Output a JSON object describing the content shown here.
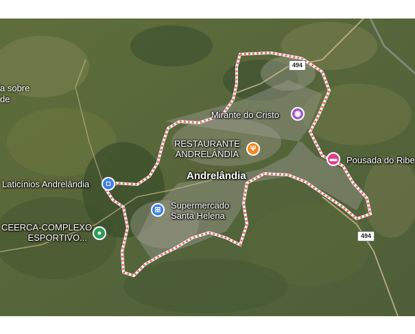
{
  "map": {
    "town_label": "Andrelândia",
    "left_edge_text": [
      "a sobre",
      "de"
    ],
    "road_shield": "494",
    "places": [
      {
        "name": "Mirante do Cristo",
        "icon": "camera-icon",
        "color": "#a259c4"
      },
      {
        "name": "RESTAURANTE\nANDRELÂNDIA",
        "icon": "fork-knife-icon",
        "color": "#f08a24"
      },
      {
        "name": "Pousada do Ribe",
        "icon": "bed-icon",
        "color": "#e0408a"
      },
      {
        "name": "Laticínios Andrelândia",
        "icon": "shopping-bag-icon",
        "color": "#3c7ef0"
      },
      {
        "name": "Supermercado\nSanta Helena",
        "icon": "shopping-cart-icon",
        "color": "#3c7ef0"
      },
      {
        "name": "CEERCA-COMPLEXO\nESPORTIVO...",
        "icon": "park-icon",
        "color": "#2e9b5a"
      }
    ],
    "boundary_color": "#e86a6a"
  }
}
